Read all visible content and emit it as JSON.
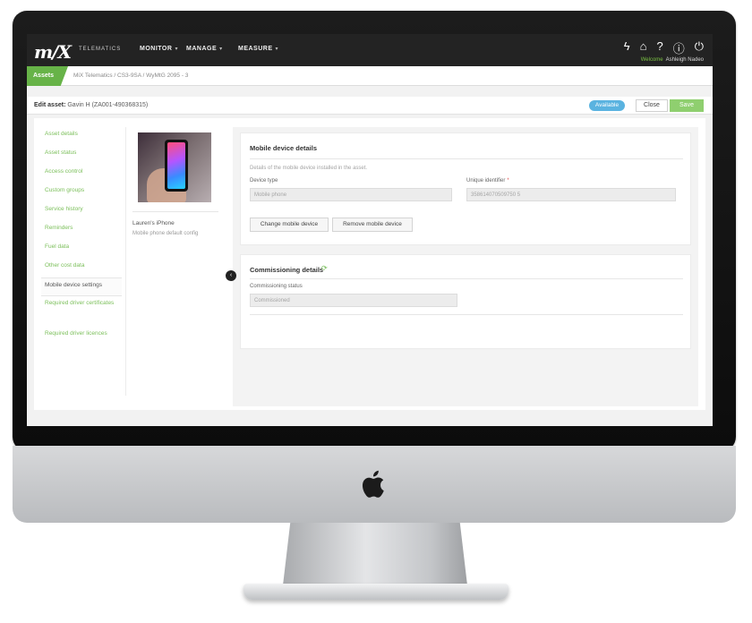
{
  "app": {
    "logo": "m/X",
    "logo_sub": "TELEMATICS",
    "nav": [
      {
        "label": "MONITOR"
      },
      {
        "label": "MANAGE"
      },
      {
        "label": "MEASURE"
      }
    ],
    "icons": [
      "bolt-icon",
      "home-icon",
      "help-icon",
      "info-icon",
      "power-icon"
    ],
    "welcome_greeting": "Welcome",
    "welcome_user": "Ashleigh Nadeo"
  },
  "breadcrumb": {
    "section": "Assets",
    "path": "MiX Telematics / CS3-9SA / WyMtG 2095 - 3"
  },
  "edit_bar": {
    "title_prefix": "Edit asset:",
    "asset_name": "Gavin H (ZA001-490368315)",
    "status_badge": "Available",
    "close_label": "Close",
    "save_label": "Save"
  },
  "sidebar": {
    "items": [
      {
        "label": "Asset details"
      },
      {
        "label": "Asset status"
      },
      {
        "label": "Access control"
      },
      {
        "label": "Custom groups"
      },
      {
        "label": "Service history"
      },
      {
        "label": "Reminders"
      },
      {
        "label": "Fuel data"
      },
      {
        "label": "Other cost data"
      },
      {
        "label": "Mobile device settings"
      },
      {
        "label": "Required driver certificates"
      },
      {
        "label": "Required driver licences"
      }
    ]
  },
  "device": {
    "name": "Lauren's iPhone",
    "config": "Mobile phone default config"
  },
  "mobile_card": {
    "title": "Mobile device details",
    "description": "Details of the mobile device installed in the asset.",
    "device_type_label": "Device type",
    "device_type_value": "Mobile phone",
    "unique_id_label": "Unique identifier",
    "unique_id_value": "358614070509750 5",
    "change_button": "Change mobile device",
    "remove_button": "Remove mobile device"
  },
  "commissioning_card": {
    "title": "Commissioning details",
    "status_label": "Commissioning status",
    "status_value": "Commissioned"
  },
  "colors": {
    "brand_green": "#67b348",
    "nav_bg": "#232323",
    "badge_blue": "#5ab3e0",
    "save_green": "#8fcf6f"
  }
}
